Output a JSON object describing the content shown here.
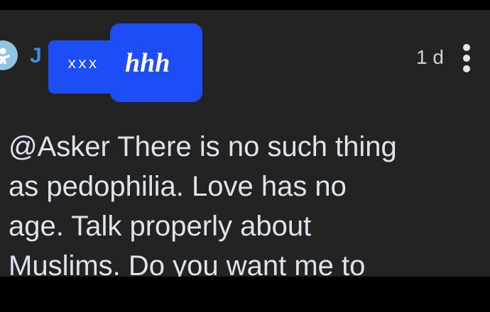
{
  "comment": {
    "author_visible": "J",
    "redaction_small_text": "xxx",
    "redaction_big_text": "hhh",
    "timestamp": "1 d",
    "more_icon": "vertical-ellipsis-icon",
    "avatar_icon": "user-avatar-icon",
    "body_lines": [
      "@Asker There is no such thing",
      "as pedophilia. Love has no",
      "age. Talk properly about",
      "Muslims. Do you want me to"
    ]
  },
  "colors": {
    "background": "#232323",
    "frame": "#000000",
    "username": "#3d8ee6",
    "redaction": "#1d4ef5",
    "body_text": "#dde4ee",
    "timestamp": "#d2d2d2"
  }
}
